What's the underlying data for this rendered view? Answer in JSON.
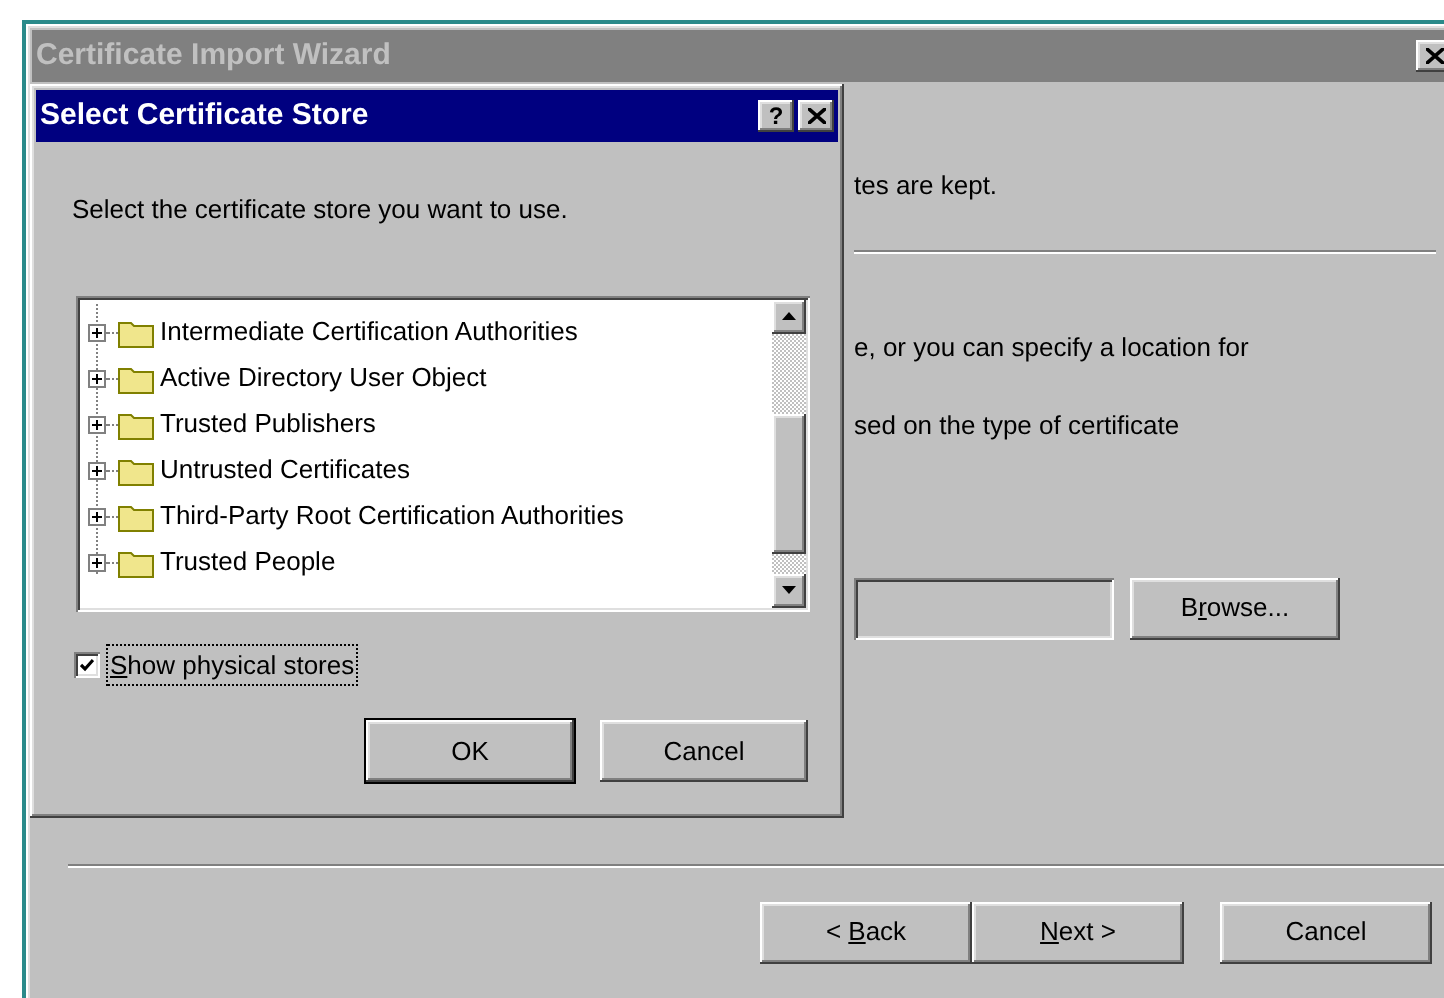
{
  "wizard": {
    "title": "Certificate Import Wizard",
    "texts": [
      "tes are kept.",
      "e, or you can specify a location for",
      "sed on the type of certificate"
    ],
    "browse_button": {
      "label_parts": [
        {
          "text": "B"
        },
        {
          "text": "r",
          "underlined": true
        },
        {
          "text": "owse..."
        }
      ]
    },
    "buttons": [
      {
        "label_parts": [
          {
            "text": "< "
          },
          {
            "text": "B",
            "underlined": true
          },
          {
            "text": "ack"
          }
        ]
      },
      {
        "label_parts": [
          {
            "text": "N",
            "underlined": true
          },
          {
            "text": "ext >"
          }
        ]
      },
      {
        "label_parts": [
          {
            "text": "Cancel"
          }
        ]
      }
    ]
  },
  "dialog": {
    "title": "Select Certificate Store",
    "help_button": "?",
    "instruction": "Select the certificate store you want to use.",
    "stores": [
      {
        "name": "Intermediate Certification Authorities",
        "expanded": false
      },
      {
        "name": "Active Directory User Object",
        "expanded": false
      },
      {
        "name": "Trusted Publishers",
        "expanded": false
      },
      {
        "name": "Untrusted Certificates",
        "expanded": false
      },
      {
        "name": "Third-Party Root Certification Authorities",
        "expanded": false
      },
      {
        "name": "Trusted People",
        "expanded": false
      }
    ],
    "show_physical_stores": {
      "label_parts": [
        {
          "text": "S",
          "underlined": true
        },
        {
          "text": "how physical stores"
        }
      ],
      "checked": true,
      "focused": true
    },
    "buttons": [
      {
        "label_parts": [
          {
            "text": "OK"
          }
        ],
        "default": true
      },
      {
        "label_parts": [
          {
            "text": "Cancel"
          }
        ],
        "default": false
      }
    ]
  }
}
